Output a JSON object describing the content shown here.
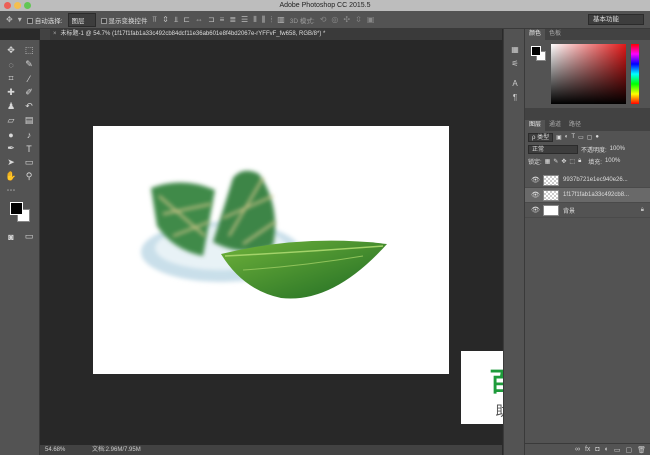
{
  "window": {
    "title": "Adobe Photoshop CC 2015.5"
  },
  "options_bar": {
    "auto_select_label": "自动选择:",
    "auto_select_value": "图层",
    "show_transform_label": "显示变换控件",
    "mode_3d_label": "3D 模式:",
    "workspace": "基本功能"
  },
  "document": {
    "tab_title": "未标题-1 @ 54.7% (1f17f1fab1a33c492cb84dcf11e36ab601e8f4bd2067e-rYFFvF_fw658, RGB/8*) *",
    "tab_close": "×"
  },
  "status": {
    "zoom": "54.68%",
    "doc_size": "文档:2.96M/7.95M"
  },
  "watermark": {
    "title": "百科全说",
    "subtitle": "助你轻松解决"
  },
  "color_panel": {
    "tabs": [
      "颜色",
      "色板"
    ]
  },
  "layers_panel": {
    "tabs": [
      "图层",
      "通道",
      "路径"
    ],
    "filter_value": "ρ 类型",
    "blend_mode": "正常",
    "opacity_label": "不透明度:",
    "opacity_value": "100%",
    "lock_label": "锁定:",
    "fill_label": "填充:",
    "fill_value": "100%",
    "layers": [
      {
        "name": "9937b721e1ec940e26...",
        "selected": false
      },
      {
        "name": "1f17f1fab1a33c492cb8...",
        "selected": true
      },
      {
        "name": "背景",
        "selected": false
      }
    ]
  },
  "icons": {
    "move": "move-icon",
    "eye": "eye-icon",
    "lock": "lock-icon"
  }
}
